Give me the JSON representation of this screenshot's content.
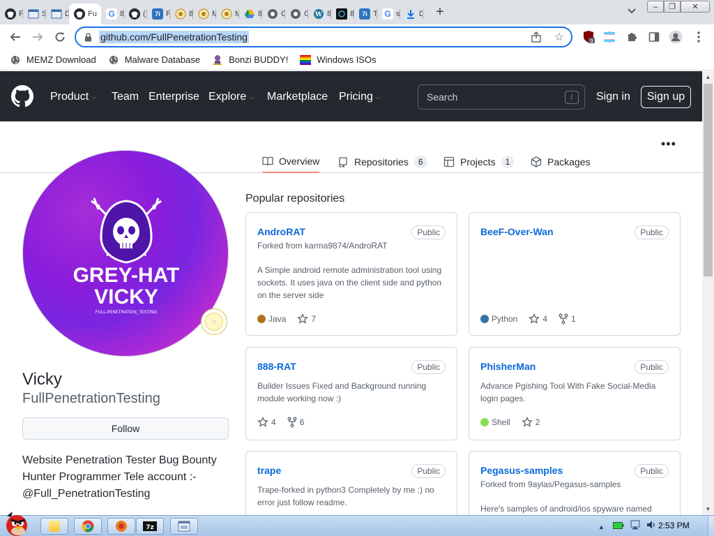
{
  "browser": {
    "tabs": [
      {
        "icon": "github-favicon",
        "label": "F",
        "color": "#24292f"
      },
      {
        "icon": "window-favicon",
        "label": "S",
        "color": "#3c6aa8"
      },
      {
        "icon": "window-favicon",
        "label": "D",
        "color": "#3c6aa8"
      },
      {
        "icon": "github-favicon",
        "label": "Fu",
        "active": true
      },
      {
        "icon": "google-favicon",
        "label": "8",
        "color": "#4285f4"
      },
      {
        "icon": "github-favicon",
        "label": "(",
        "color": "#24292f"
      },
      {
        "icon": "7zip-favicon",
        "label": "F",
        "color": "#2f74c0"
      },
      {
        "icon": "badge-favicon",
        "label": "8",
        "color": "#b8860b"
      },
      {
        "icon": "badge-favicon",
        "label": "M",
        "color": "#b8860b"
      },
      {
        "icon": "badge-favicon",
        "label": "M",
        "color": "#b8860b"
      },
      {
        "icon": "drive-favicon",
        "label": "8",
        "color": "#0f9d58"
      },
      {
        "icon": "globe-favicon",
        "label": "C",
        "color": "#5f6368"
      },
      {
        "icon": "globe-favicon",
        "label": "C",
        "color": "#5f6368"
      },
      {
        "icon": "wordpress-favicon",
        "label": "8",
        "color": "#21759b"
      },
      {
        "icon": "dark-favicon",
        "label": "8",
        "color": "#111111"
      },
      {
        "icon": "7zip-favicon",
        "label": "T",
        "color": "#2f74c0"
      },
      {
        "icon": "google-favicon",
        "label": "s",
        "color": "#4285f4"
      },
      {
        "icon": "download-favicon",
        "label": "D",
        "color": "#1a73e8"
      }
    ],
    "url": "github.com/FullPenetrationTesting",
    "extension_badge": "3",
    "bookmarks": [
      {
        "label": "MEMZ Download",
        "icon": "globe-icon"
      },
      {
        "label": "Malware Database",
        "icon": "globe-icon"
      },
      {
        "label": "Bonzi BUDDY!",
        "icon": "bonzi-icon"
      },
      {
        "label": "Windows ISOs",
        "icon": "rainbow-flag-icon"
      }
    ]
  },
  "github": {
    "nav": {
      "product": "Product",
      "team": "Team",
      "enterprise": "Enterprise",
      "explore": "Explore",
      "marketplace": "Marketplace",
      "pricing": "Pricing",
      "search_placeholder": "Search",
      "search_hint": "/",
      "sign_in": "Sign in",
      "sign_up": "Sign up"
    },
    "tabs": {
      "overview": "Overview",
      "repositories": "Repositories",
      "repositories_count": "6",
      "projects": "Projects",
      "projects_count": "1",
      "packages": "Packages"
    },
    "profile": {
      "avatar_line1": "GREY-HAT",
      "avatar_line2": "VICKY",
      "avatar_caption": "FULL-PENETRATION_TESTING",
      "name": "Vicky",
      "username": "FullPenetrationTesting",
      "follow": "Follow",
      "bio": "Website Penetration Tester Bug Bounty Hunter Programmer Tele account :- @Full_PenetrationTesting"
    },
    "popular_title": "Popular repositories",
    "repos": [
      {
        "name": "AndroRAT",
        "visibility": "Public",
        "fork": "Forked from karma9874/AndroRAT",
        "description": "A Simple android remote administration tool using sockets. It uses java on the client side and python on the server side",
        "language": "Java",
        "language_color": "#b07219",
        "stars": "7",
        "forks": ""
      },
      {
        "name": "BeeF-Over-Wan",
        "visibility": "Public",
        "fork": "",
        "description": "",
        "language": "Python",
        "language_color": "#3572a5",
        "stars": "4",
        "forks": "1"
      },
      {
        "name": "888-RAT",
        "visibility": "Public",
        "fork": "",
        "description": "Builder Issues Fixed and Background running module working now :)",
        "language": "",
        "language_color": "",
        "stars": "4",
        "forks": "6"
      },
      {
        "name": "PhisherMan",
        "visibility": "Public",
        "fork": "",
        "description": "Advance Pgishing Tool With Fake Social-Media login pages.",
        "language": "Shell",
        "language_color": "#89e051",
        "stars": "2",
        "forks": ""
      },
      {
        "name": "trape",
        "visibility": "Public",
        "fork": "",
        "description": "Trape-forked in python3 Completely by me :) no error just follow readme.",
        "language": "",
        "language_color": "",
        "stars": "",
        "forks": ""
      },
      {
        "name": "Pegasus-samples",
        "visibility": "Public",
        "fork": "Forked from 9aylas/Pegasus-samples",
        "description": "Here's samples of android/ios spyware named",
        "language": "",
        "language_color": "",
        "stars": "",
        "forks": ""
      }
    ]
  },
  "taskbar": {
    "clock": "2:53 PM"
  }
}
